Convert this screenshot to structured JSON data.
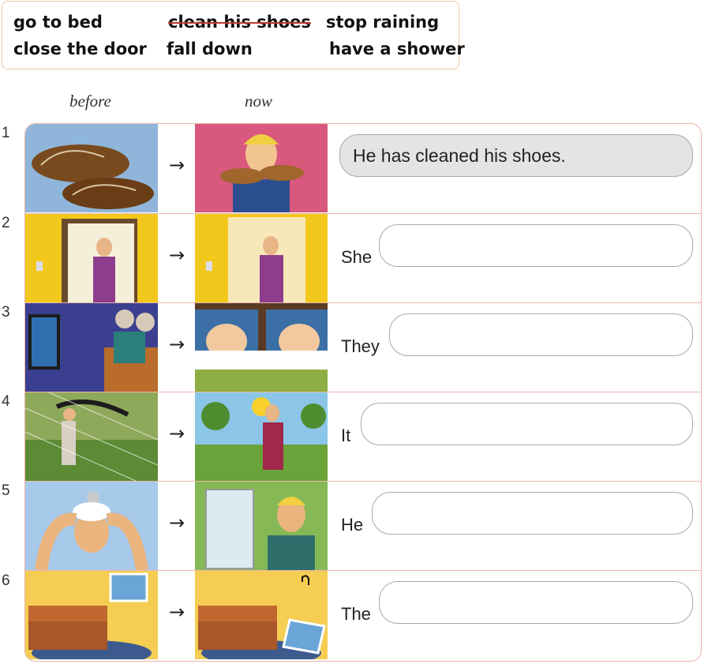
{
  "word_bank": {
    "words": [
      "go to bed",
      "clean his shoes",
      "stop raining",
      "close the door",
      "fall down",
      "have a shower"
    ],
    "struck_word_index": 1
  },
  "headings": {
    "before": "before",
    "now": "now"
  },
  "arrow_symbol": "→",
  "rows": [
    {
      "number": "1",
      "prompt": "",
      "answer": "He has cleaned his shoes.",
      "before_image": "muddy-shoes-image",
      "now_image": "man-holding-shoes-image"
    },
    {
      "number": "2",
      "prompt": "She",
      "answer": "",
      "before_image": "woman-open-door-image",
      "now_image": "woman-closed-door-image"
    },
    {
      "number": "3",
      "prompt": "They",
      "answer": "",
      "before_image": "couple-watching-tv-image",
      "now_image": "couple-in-bed-image"
    },
    {
      "number": "4",
      "prompt": "It",
      "answer": "",
      "before_image": "man-in-rain-image",
      "now_image": "woman-in-sunshine-image"
    },
    {
      "number": "5",
      "prompt": "He",
      "answer": "",
      "before_image": "man-washing-hair-image",
      "now_image": "man-after-shower-image"
    },
    {
      "number": "6",
      "prompt": "The",
      "answer": "",
      "before_image": "picture-on-wall-image",
      "now_image": "picture-fallen-image"
    }
  ],
  "colors": {
    "border": "#e9b3a8",
    "wordbank_border": "#ecc9a3",
    "filled_answer_bg": "#e4e4e4",
    "strike": "#c0392b"
  }
}
